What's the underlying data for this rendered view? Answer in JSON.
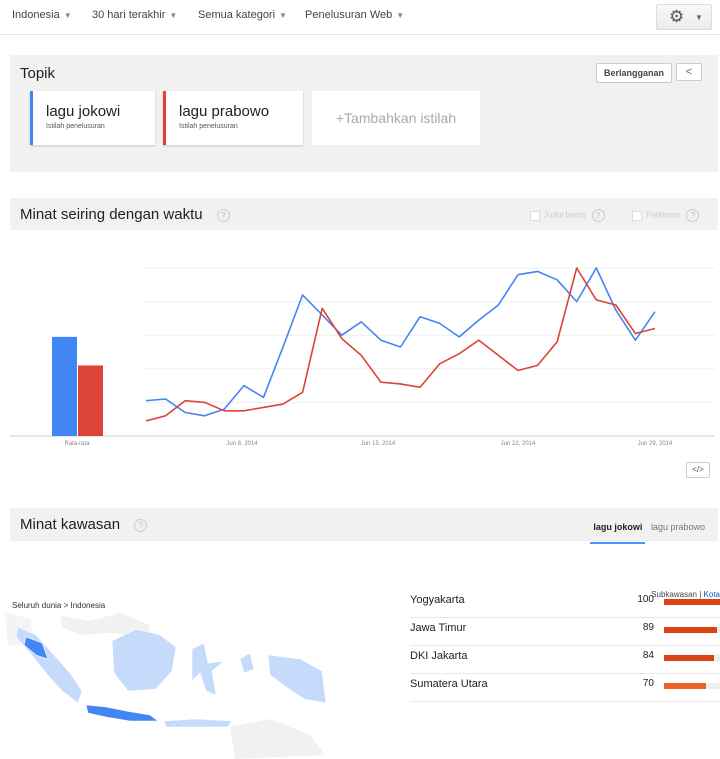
{
  "filters": [
    "Indonesia",
    "30 hari terakhir",
    "Semua kategori",
    "Penelusuran Web"
  ],
  "topics": {
    "title": "Topik",
    "subscribe_label": "Berlangganan",
    "share_icon": "share-icon",
    "terms": [
      {
        "name": "lagu jokowi",
        "sub": "Istilah penelusuran",
        "color": "#4285f4"
      },
      {
        "name": "lagu prabowo",
        "sub": "Istilah penelusuran",
        "color": "#db4437"
      }
    ],
    "add_label": "+Tambahkan istilah"
  },
  "interest": {
    "title": "Minat seiring dengan waktu",
    "help": "?",
    "check_news": "Judul berita",
    "check_forecast": "Perkiraan",
    "embed_label": "</>"
  },
  "chart_data": {
    "type": "line",
    "average": {
      "label": "Rata-rata",
      "values": [
        59,
        42
      ]
    },
    "x_ticks": [
      "Jun 8, 2014",
      "Jun 15, 2014",
      "Jun 22, 2014",
      "Jun 29, 2014"
    ],
    "series": [
      {
        "color": "#4285f4",
        "values": [
          21,
          22,
          14,
          12,
          16,
          30,
          23,
          53,
          84,
          72,
          60,
          68,
          57,
          53,
          71,
          67,
          59,
          69,
          78,
          96,
          98,
          93,
          80,
          100,
          75,
          57,
          74
        ]
      },
      {
        "color": "#db4437",
        "values": [
          9,
          12,
          21,
          20,
          15,
          15,
          17,
          19,
          26,
          76,
          58,
          48,
          32,
          31,
          29,
          43,
          49,
          57,
          48,
          39,
          42,
          56,
          100,
          81,
          78,
          61,
          64
        ]
      }
    ],
    "ylim": [
      0,
      100
    ]
  },
  "region": {
    "title": "Minat kawasan",
    "help": "?",
    "tabs": [
      "lagu jokowi",
      "lagu prabowo"
    ],
    "crumb": "Seluruh dunia > Indonesia",
    "sub_label": "Subkawasan",
    "sep": "|",
    "city_label": "Kota",
    "rows": [
      {
        "name": "Yogyakarta",
        "value": "100",
        "pct": 100,
        "color": "#d84315"
      },
      {
        "name": "Jawa Timur",
        "value": "89",
        "pct": 89,
        "color": "#d84315"
      },
      {
        "name": "DKI Jakarta",
        "value": "84",
        "pct": 84,
        "color": "#d84315"
      },
      {
        "name": "Sumatera Utara",
        "value": "70",
        "pct": 70,
        "color": "#e8622a"
      }
    ]
  }
}
